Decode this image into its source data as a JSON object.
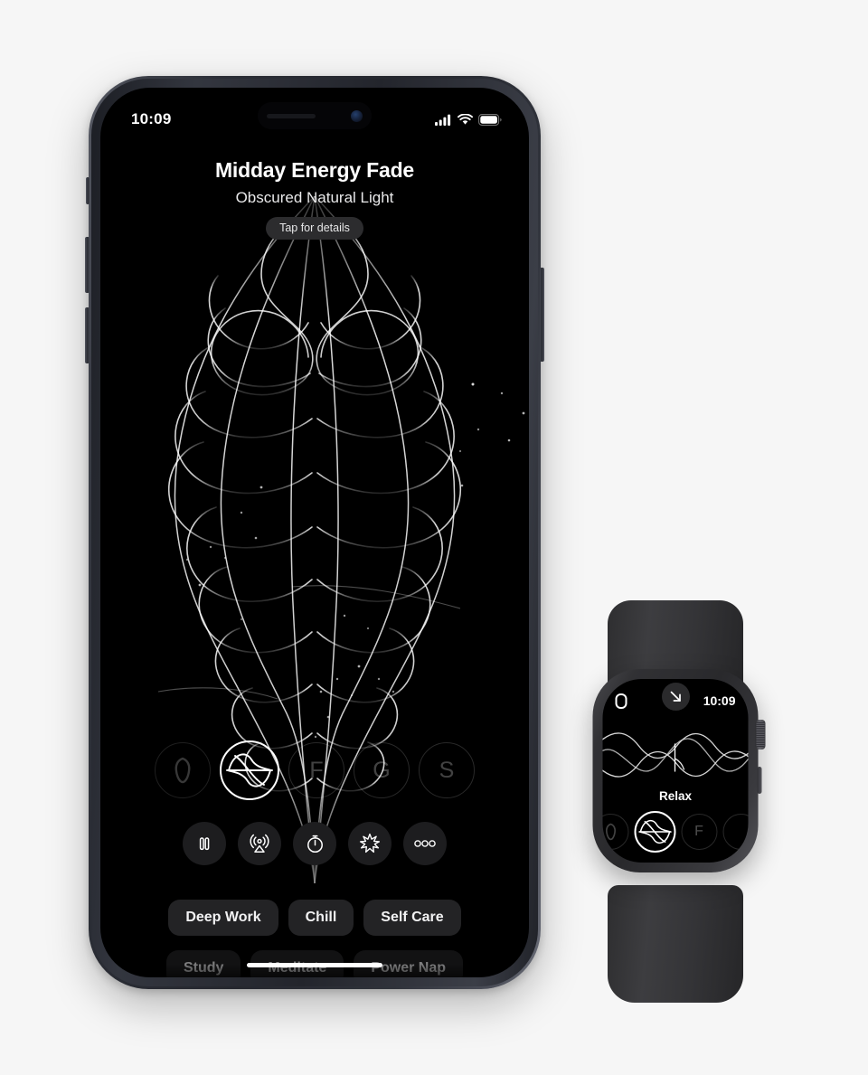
{
  "page": {
    "background_color": "#f6f6f6",
    "devices": [
      "iphone",
      "apple-watch"
    ]
  },
  "phone": {
    "status_bar": {
      "time": "10:09",
      "cellular_icon": "signal-bars-icon",
      "wifi_icon": "wifi-icon",
      "battery_icon": "battery-full-icon"
    },
    "app": {
      "title": "Midday Energy Fade",
      "subtitle": "Obscured Natural Light",
      "details_pill": "Tap for details"
    },
    "scenes": [
      {
        "name": "scene-previous",
        "glyph": "",
        "state": "dim",
        "type": "leaf"
      },
      {
        "name": "scene-active",
        "glyph": "",
        "state": "active",
        "type": "wave-emblem"
      },
      {
        "name": "scene-f",
        "glyph": "F",
        "state": "dim",
        "type": "letter"
      },
      {
        "name": "scene-g",
        "glyph": "G",
        "state": "dim",
        "type": "letter"
      },
      {
        "name": "scene-s",
        "glyph": "S",
        "state": "dim",
        "type": "letter"
      }
    ],
    "controls": [
      {
        "name": "pause-button",
        "icon": "pause-icon"
      },
      {
        "name": "airplay-button",
        "icon": "airplay-icon"
      },
      {
        "name": "timer-button",
        "icon": "stopwatch-icon"
      },
      {
        "name": "effects-button",
        "icon": "sparkle-burst-icon"
      },
      {
        "name": "more-button",
        "icon": "more-horizontal-icon"
      }
    ],
    "chips_row1": [
      "Deep Work",
      "Chill",
      "Self Care"
    ],
    "chips_row2": [
      "Study",
      "Meditate",
      "Power Nap"
    ]
  },
  "watch": {
    "status_bar": {
      "app_icon": "watch-app-icon",
      "arrow_badge_icon": "arrow-down-right-icon",
      "time": "10:09"
    },
    "label": "Relax",
    "scenes": [
      {
        "name": "scene-previous",
        "glyph": "",
        "state": "dim",
        "type": "leaf"
      },
      {
        "name": "scene-active",
        "glyph": "",
        "state": "active",
        "type": "wave-emblem"
      },
      {
        "name": "scene-f",
        "glyph": "F",
        "state": "dim",
        "type": "letter"
      },
      {
        "name": "scene-next",
        "glyph": "",
        "state": "dim",
        "type": "partial"
      }
    ]
  }
}
